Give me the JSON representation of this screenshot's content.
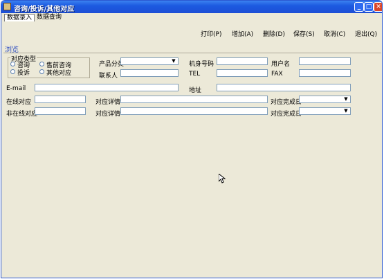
{
  "window": {
    "title": "咨询/投诉/其他对应"
  },
  "tabs": [
    {
      "label": "数据录入"
    },
    {
      "label": "数据查询"
    }
  ],
  "toolbar": {
    "print": "打印(P)",
    "add": "增加(A)",
    "delete": "删除(D)",
    "save": "保存(S)",
    "cancel": "取消(C)",
    "exit": "退出(Q)"
  },
  "section_title": "浏览",
  "form": {
    "type_group": {
      "title": "对应类型",
      "options": [
        "咨询",
        "售前咨询",
        "投诉",
        "其他对应"
      ]
    },
    "product_category": {
      "label": "产品分类",
      "value": ""
    },
    "contact": {
      "label": "联系人",
      "value": ""
    },
    "machine_no": {
      "label": "机身号码",
      "value": ""
    },
    "tel": {
      "label": "TEL",
      "value": ""
    },
    "username": {
      "label": "用户名",
      "value": ""
    },
    "fax": {
      "label": "FAX",
      "value": ""
    },
    "email": {
      "label": "E-mail",
      "value": ""
    },
    "address": {
      "label": "地址",
      "value": ""
    },
    "online": {
      "label": "在线对应",
      "detail_label": "对应详情",
      "complete_label": "对应完成日"
    },
    "offline": {
      "label": "非在线对应",
      "detail_label": "对应详情",
      "complete_label": "对应完成日"
    }
  }
}
